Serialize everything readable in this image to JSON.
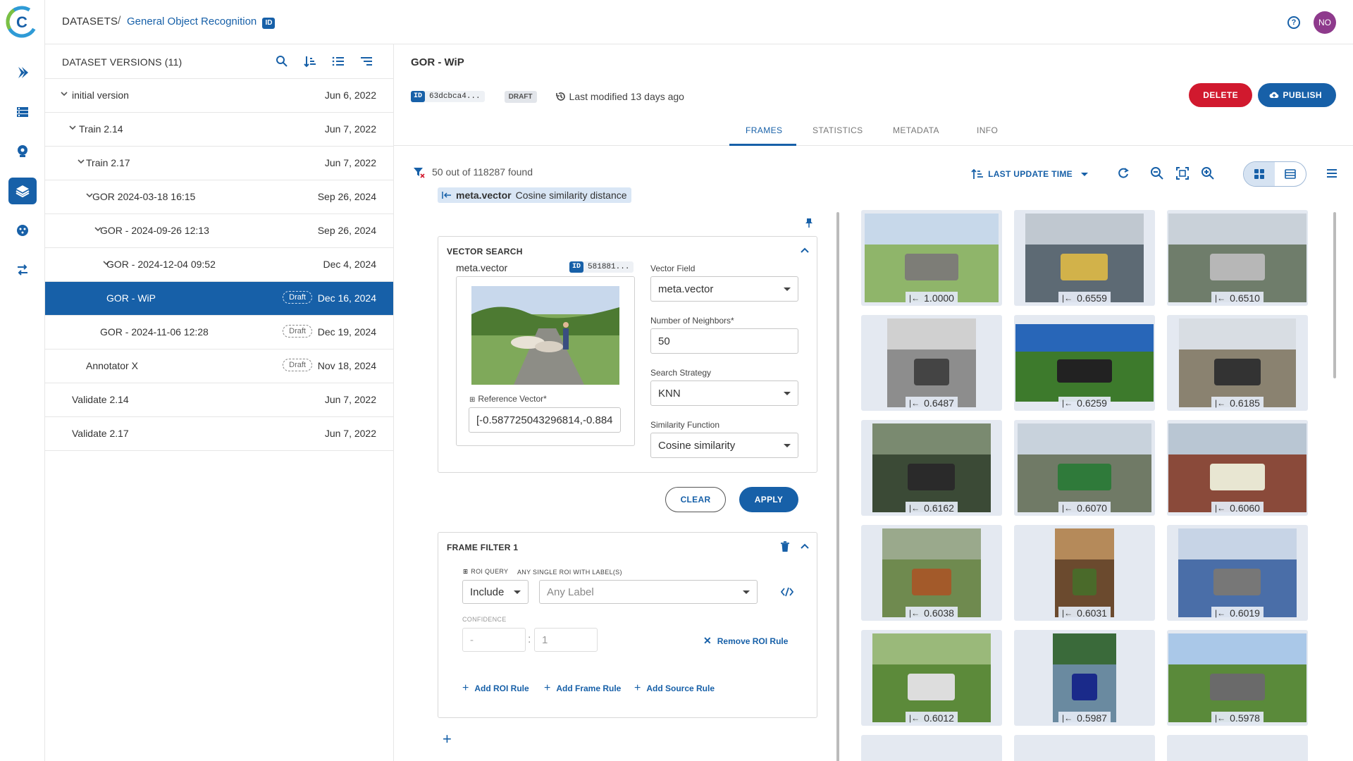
{
  "header": {
    "breadcrumb_root": "DATASETS",
    "breadcrumb_sep": "/",
    "breadcrumb_current": "General Object Recognition",
    "id_badge": "ID",
    "help": "?",
    "avatar": "NO"
  },
  "tree": {
    "title": "DATASET VERSIONS (11)",
    "draft_label": "Draft",
    "rows": [
      {
        "name": "initial version",
        "date": "Jun 6, 2022"
      },
      {
        "name": "Train 2.14",
        "date": "Jun 7, 2022"
      },
      {
        "name": "Train 2.17",
        "date": "Jun 7, 2022"
      },
      {
        "name": "GOR 2024-03-18 16:15",
        "date": "Sep 26, 2024"
      },
      {
        "name": "GOR - 2024-09-26 12:13",
        "date": "Sep 26, 2024"
      },
      {
        "name": "GOR - 2024-12-04 09:52",
        "date": "Dec 4, 2024"
      },
      {
        "name": "GOR - WiP",
        "date": "Dec 16, 2024",
        "draft": "Draft"
      },
      {
        "name": "GOR - 2024-11-06 12:28",
        "date": "Dec 19, 2024",
        "draft": "Draft"
      },
      {
        "name": "Annotator X",
        "date": "Nov 18, 2024",
        "draft": "Draft"
      },
      {
        "name": "Validate 2.14",
        "date": "Jun 7, 2022"
      },
      {
        "name": "Validate 2.17",
        "date": "Jun 7, 2022"
      }
    ]
  },
  "version": {
    "title": "GOR - WiP",
    "id_label": "ID",
    "id_value": "63dcbca4...",
    "status": "DRAFT",
    "last_modified": "Last modified 13 days ago",
    "delete_label": "DELETE",
    "publish_label": "PUBLISH"
  },
  "tabs": [
    "FRAMES",
    "STATISTICS",
    "METADATA",
    "INFO"
  ],
  "results": {
    "found_text": "50 out of 118287 found",
    "query_field": "meta.vector",
    "query_desc": "Cosine similarity distance",
    "sort_label": "LAST UPDATE TIME"
  },
  "vector_search": {
    "title": "VECTOR SEARCH",
    "field_name": "meta.vector",
    "id_label": "ID",
    "id_value": "581881...",
    "ref_label": "Reference Vector*",
    "ref_value": "[-0.587725043296814,-0.884",
    "vector_field_label": "Vector Field",
    "vector_field_value": "meta.vector",
    "neighbors_label": "Number of Neighbors*",
    "neighbors_value": "50",
    "strategy_label": "Search Strategy",
    "strategy_value": "KNN",
    "similarity_label": "Similarity Function",
    "similarity_value": "Cosine similarity",
    "clear_label": "CLEAR",
    "apply_label": "APPLY"
  },
  "frame_filter": {
    "title": "FRAME FILTER 1",
    "roi_query_label": "ROI QUERY",
    "roi_label_label": "ANY SINGLE ROI WITH LABEL(S)",
    "include_value": "Include",
    "label_placeholder": "Any Label",
    "confidence_label": "CONFIDENCE",
    "conf_min_placeholder": "-",
    "conf_max_value": "1",
    "conf_sep": ":",
    "remove_roi_label": "Remove ROI Rule",
    "add_roi_label": "Add ROI Rule",
    "add_frame_label": "Add Frame Rule",
    "add_source_label": "Add Source Rule"
  },
  "frames": [
    {
      "score": "1.0000",
      "icon": "cows-road-image"
    },
    {
      "score": "0.6559",
      "icon": "bus-image"
    },
    {
      "score": "0.6510",
      "icon": "cars-image"
    },
    {
      "score": "0.6487",
      "icon": "motorcycle-image"
    },
    {
      "score": "0.6259",
      "icon": "cattle-field-image"
    },
    {
      "score": "0.6185",
      "icon": "cow-trees-image"
    },
    {
      "score": "0.6162",
      "icon": "people-image"
    },
    {
      "score": "0.6070",
      "icon": "street-sign-image"
    },
    {
      "score": "0.6060",
      "icon": "police-car-image"
    },
    {
      "score": "0.6038",
      "icon": "horse-riders-image"
    },
    {
      "score": "0.6031",
      "icon": "cow-image"
    },
    {
      "score": "0.6019",
      "icon": "bus-street-image"
    },
    {
      "score": "0.6012",
      "icon": "hydrant-image"
    },
    {
      "score": "0.5987",
      "icon": "motorbike-image"
    },
    {
      "score": "0.5978",
      "icon": "elephant-image"
    }
  ],
  "colors": {
    "accent": "#1760a8",
    "danger": "#d1192e",
    "avatar": "#8e3a8c"
  }
}
